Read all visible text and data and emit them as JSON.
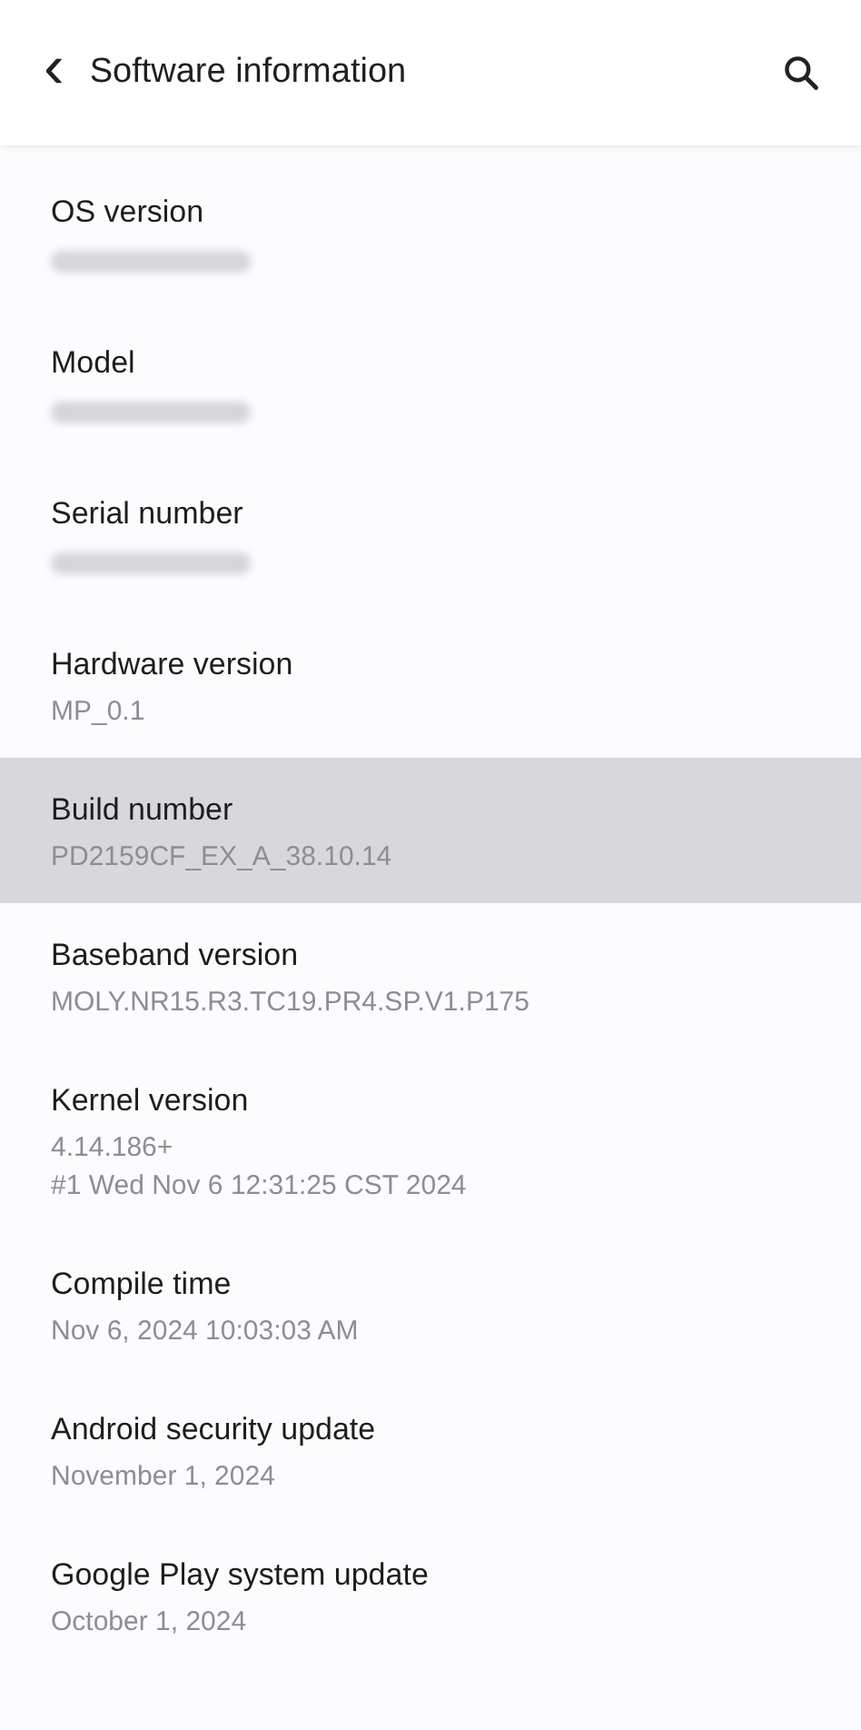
{
  "header": {
    "back": "‹",
    "title": "Software information"
  },
  "items": [
    {
      "label": "OS version",
      "kind": "redacted",
      "selected": false
    },
    {
      "label": "Model",
      "kind": "redacted",
      "selected": false
    },
    {
      "label": "Serial number",
      "kind": "redacted",
      "selected": false
    },
    {
      "label": "Hardware version",
      "kind": "text",
      "value": "MP_0.1",
      "selected": false
    },
    {
      "label": "Build number",
      "kind": "text",
      "value": "PD2159CF_EX_A_38.10.14",
      "selected": true
    },
    {
      "label": "Baseband version",
      "kind": "text",
      "value": "MOLY.NR15.R3.TC19.PR4.SP.V1.P175",
      "selected": false
    },
    {
      "label": "Kernel version",
      "kind": "text",
      "value": "4.14.186+\n#1 Wed Nov 6 12:31:25 CST 2024",
      "selected": false
    },
    {
      "label": "Compile time",
      "kind": "text",
      "value": "Nov 6, 2024 10:03:03 AM",
      "selected": false
    },
    {
      "label": "Android security update",
      "kind": "text",
      "value": "November 1, 2024",
      "selected": false
    },
    {
      "label": "Google Play system update",
      "kind": "text",
      "value": "October 1, 2024",
      "selected": false
    }
  ]
}
